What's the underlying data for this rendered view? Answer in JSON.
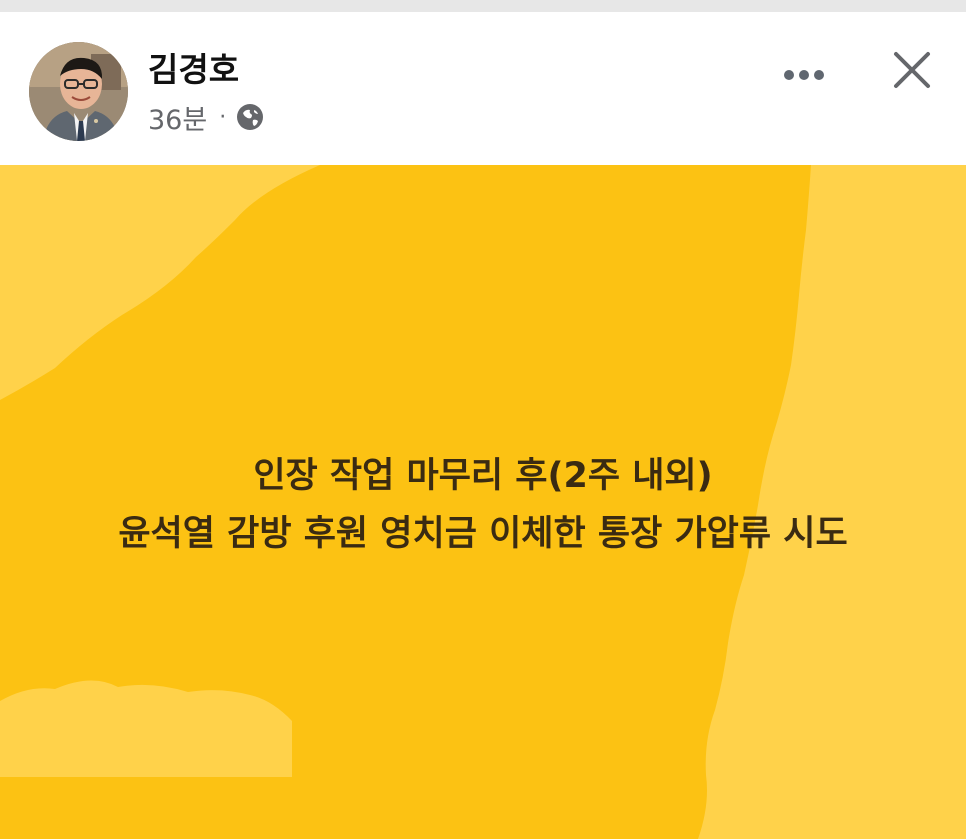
{
  "post": {
    "author": "김경호",
    "time_ago": "36분",
    "separator": "·",
    "privacy_icon": "globe-icon",
    "more_icon": "more-horizontal-icon",
    "close_icon": "close-icon"
  },
  "card": {
    "background_color": "#fcc213",
    "lighter_shape_color": "#ffd24a",
    "text_color": "#3a2b12",
    "lines": [
      "인장 작업 마무리 후(2주 내외)",
      "윤석열 감방 후원 영치금 이체한 통장 가압류 시도"
    ]
  }
}
